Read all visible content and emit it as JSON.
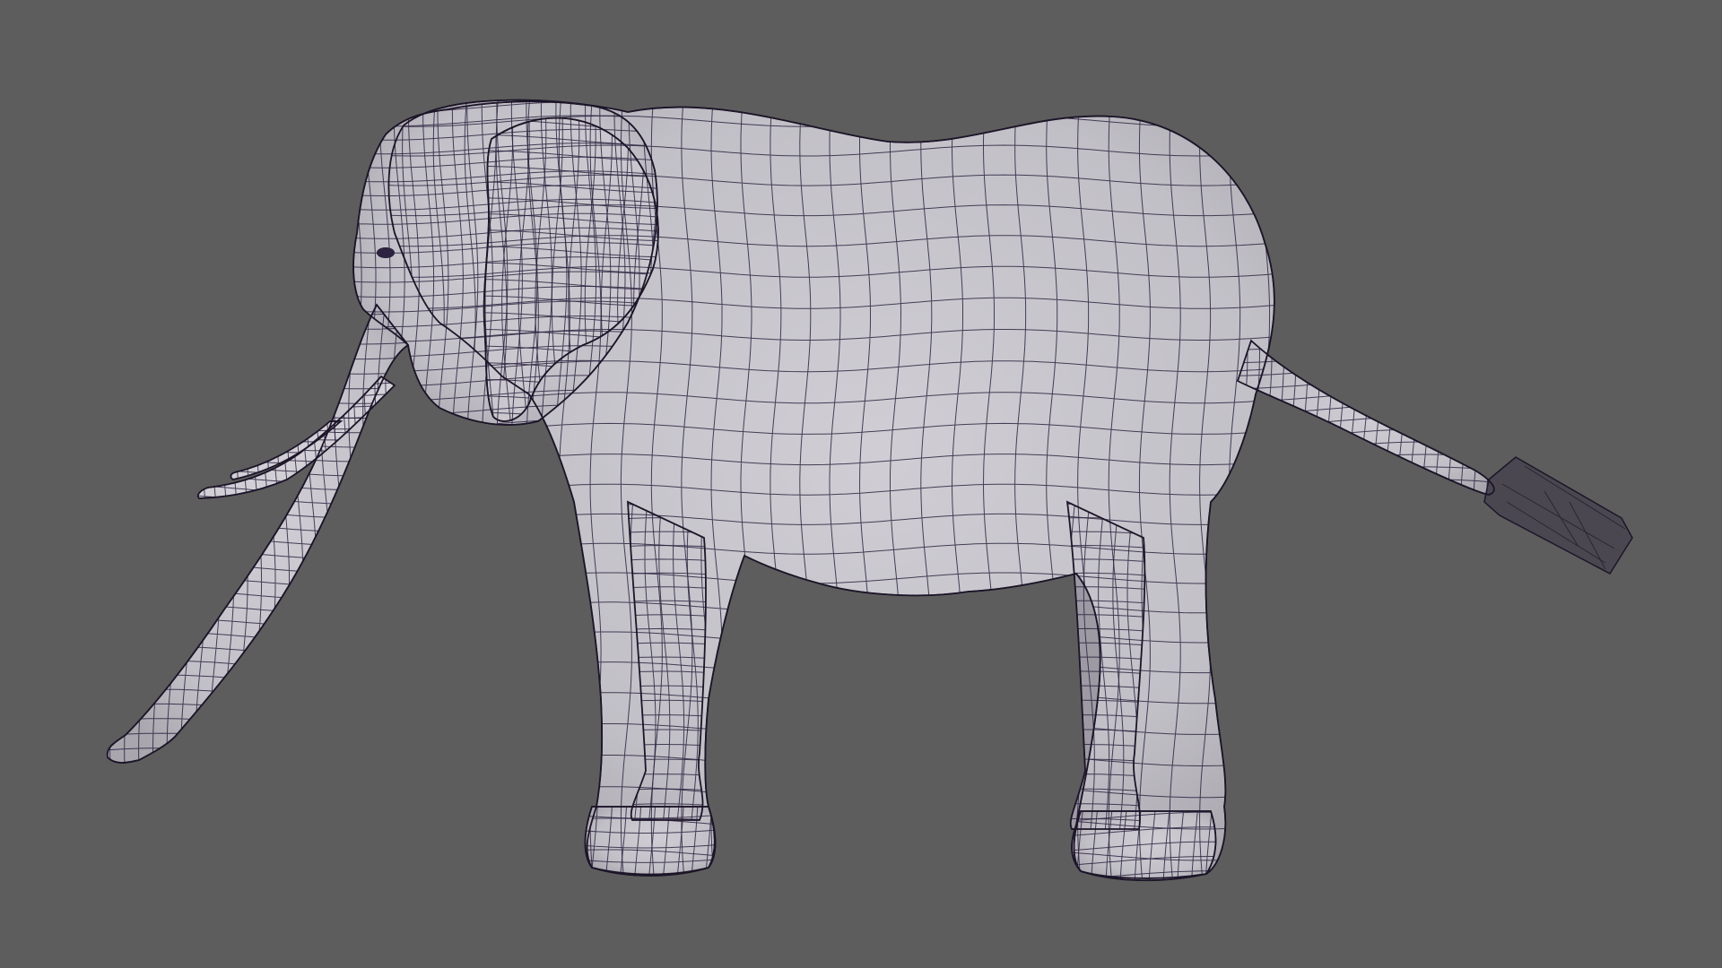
{
  "viewport": {
    "background_color": "#5d5d5d",
    "mesh_fill_color": "#c7c5cb",
    "mesh_shadow_color": "#9d9aa3",
    "wire_color": "#2c2340",
    "outline_color": "#1c1528",
    "tuft_color": "#4a4750",
    "shading": "wireframe-on-shaded",
    "view": "side-orthographic"
  },
  "model": {
    "subject": "elephant",
    "icon": "elephant-mesh-icon"
  }
}
